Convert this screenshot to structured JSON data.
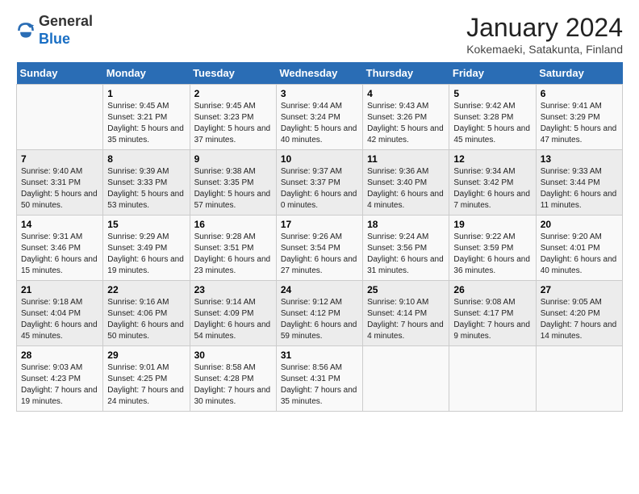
{
  "header": {
    "logo": {
      "general": "General",
      "blue": "Blue"
    },
    "title": "January 2024",
    "subtitle": "Kokemaeki, Satakunta, Finland"
  },
  "days_of_week": [
    "Sunday",
    "Monday",
    "Tuesday",
    "Wednesday",
    "Thursday",
    "Friday",
    "Saturday"
  ],
  "weeks": [
    [
      {
        "day": "",
        "sunrise": "",
        "sunset": "",
        "daylight": ""
      },
      {
        "day": "1",
        "sunrise": "Sunrise: 9:45 AM",
        "sunset": "Sunset: 3:21 PM",
        "daylight": "Daylight: 5 hours and 35 minutes."
      },
      {
        "day": "2",
        "sunrise": "Sunrise: 9:45 AM",
        "sunset": "Sunset: 3:23 PM",
        "daylight": "Daylight: 5 hours and 37 minutes."
      },
      {
        "day": "3",
        "sunrise": "Sunrise: 9:44 AM",
        "sunset": "Sunset: 3:24 PM",
        "daylight": "Daylight: 5 hours and 40 minutes."
      },
      {
        "day": "4",
        "sunrise": "Sunrise: 9:43 AM",
        "sunset": "Sunset: 3:26 PM",
        "daylight": "Daylight: 5 hours and 42 minutes."
      },
      {
        "day": "5",
        "sunrise": "Sunrise: 9:42 AM",
        "sunset": "Sunset: 3:28 PM",
        "daylight": "Daylight: 5 hours and 45 minutes."
      },
      {
        "day": "6",
        "sunrise": "Sunrise: 9:41 AM",
        "sunset": "Sunset: 3:29 PM",
        "daylight": "Daylight: 5 hours and 47 minutes."
      }
    ],
    [
      {
        "day": "7",
        "sunrise": "Sunrise: 9:40 AM",
        "sunset": "Sunset: 3:31 PM",
        "daylight": "Daylight: 5 hours and 50 minutes."
      },
      {
        "day": "8",
        "sunrise": "Sunrise: 9:39 AM",
        "sunset": "Sunset: 3:33 PM",
        "daylight": "Daylight: 5 hours and 53 minutes."
      },
      {
        "day": "9",
        "sunrise": "Sunrise: 9:38 AM",
        "sunset": "Sunset: 3:35 PM",
        "daylight": "Daylight: 5 hours and 57 minutes."
      },
      {
        "day": "10",
        "sunrise": "Sunrise: 9:37 AM",
        "sunset": "Sunset: 3:37 PM",
        "daylight": "Daylight: 6 hours and 0 minutes."
      },
      {
        "day": "11",
        "sunrise": "Sunrise: 9:36 AM",
        "sunset": "Sunset: 3:40 PM",
        "daylight": "Daylight: 6 hours and 4 minutes."
      },
      {
        "day": "12",
        "sunrise": "Sunrise: 9:34 AM",
        "sunset": "Sunset: 3:42 PM",
        "daylight": "Daylight: 6 hours and 7 minutes."
      },
      {
        "day": "13",
        "sunrise": "Sunrise: 9:33 AM",
        "sunset": "Sunset: 3:44 PM",
        "daylight": "Daylight: 6 hours and 11 minutes."
      }
    ],
    [
      {
        "day": "14",
        "sunrise": "Sunrise: 9:31 AM",
        "sunset": "Sunset: 3:46 PM",
        "daylight": "Daylight: 6 hours and 15 minutes."
      },
      {
        "day": "15",
        "sunrise": "Sunrise: 9:29 AM",
        "sunset": "Sunset: 3:49 PM",
        "daylight": "Daylight: 6 hours and 19 minutes."
      },
      {
        "day": "16",
        "sunrise": "Sunrise: 9:28 AM",
        "sunset": "Sunset: 3:51 PM",
        "daylight": "Daylight: 6 hours and 23 minutes."
      },
      {
        "day": "17",
        "sunrise": "Sunrise: 9:26 AM",
        "sunset": "Sunset: 3:54 PM",
        "daylight": "Daylight: 6 hours and 27 minutes."
      },
      {
        "day": "18",
        "sunrise": "Sunrise: 9:24 AM",
        "sunset": "Sunset: 3:56 PM",
        "daylight": "Daylight: 6 hours and 31 minutes."
      },
      {
        "day": "19",
        "sunrise": "Sunrise: 9:22 AM",
        "sunset": "Sunset: 3:59 PM",
        "daylight": "Daylight: 6 hours and 36 minutes."
      },
      {
        "day": "20",
        "sunrise": "Sunrise: 9:20 AM",
        "sunset": "Sunset: 4:01 PM",
        "daylight": "Daylight: 6 hours and 40 minutes."
      }
    ],
    [
      {
        "day": "21",
        "sunrise": "Sunrise: 9:18 AM",
        "sunset": "Sunset: 4:04 PM",
        "daylight": "Daylight: 6 hours and 45 minutes."
      },
      {
        "day": "22",
        "sunrise": "Sunrise: 9:16 AM",
        "sunset": "Sunset: 4:06 PM",
        "daylight": "Daylight: 6 hours and 50 minutes."
      },
      {
        "day": "23",
        "sunrise": "Sunrise: 9:14 AM",
        "sunset": "Sunset: 4:09 PM",
        "daylight": "Daylight: 6 hours and 54 minutes."
      },
      {
        "day": "24",
        "sunrise": "Sunrise: 9:12 AM",
        "sunset": "Sunset: 4:12 PM",
        "daylight": "Daylight: 6 hours and 59 minutes."
      },
      {
        "day": "25",
        "sunrise": "Sunrise: 9:10 AM",
        "sunset": "Sunset: 4:14 PM",
        "daylight": "Daylight: 7 hours and 4 minutes."
      },
      {
        "day": "26",
        "sunrise": "Sunrise: 9:08 AM",
        "sunset": "Sunset: 4:17 PM",
        "daylight": "Daylight: 7 hours and 9 minutes."
      },
      {
        "day": "27",
        "sunrise": "Sunrise: 9:05 AM",
        "sunset": "Sunset: 4:20 PM",
        "daylight": "Daylight: 7 hours and 14 minutes."
      }
    ],
    [
      {
        "day": "28",
        "sunrise": "Sunrise: 9:03 AM",
        "sunset": "Sunset: 4:23 PM",
        "daylight": "Daylight: 7 hours and 19 minutes."
      },
      {
        "day": "29",
        "sunrise": "Sunrise: 9:01 AM",
        "sunset": "Sunset: 4:25 PM",
        "daylight": "Daylight: 7 hours and 24 minutes."
      },
      {
        "day": "30",
        "sunrise": "Sunrise: 8:58 AM",
        "sunset": "Sunset: 4:28 PM",
        "daylight": "Daylight: 7 hours and 30 minutes."
      },
      {
        "day": "31",
        "sunrise": "Sunrise: 8:56 AM",
        "sunset": "Sunset: 4:31 PM",
        "daylight": "Daylight: 7 hours and 35 minutes."
      },
      {
        "day": "",
        "sunrise": "",
        "sunset": "",
        "daylight": ""
      },
      {
        "day": "",
        "sunrise": "",
        "sunset": "",
        "daylight": ""
      },
      {
        "day": "",
        "sunrise": "",
        "sunset": "",
        "daylight": ""
      }
    ]
  ]
}
